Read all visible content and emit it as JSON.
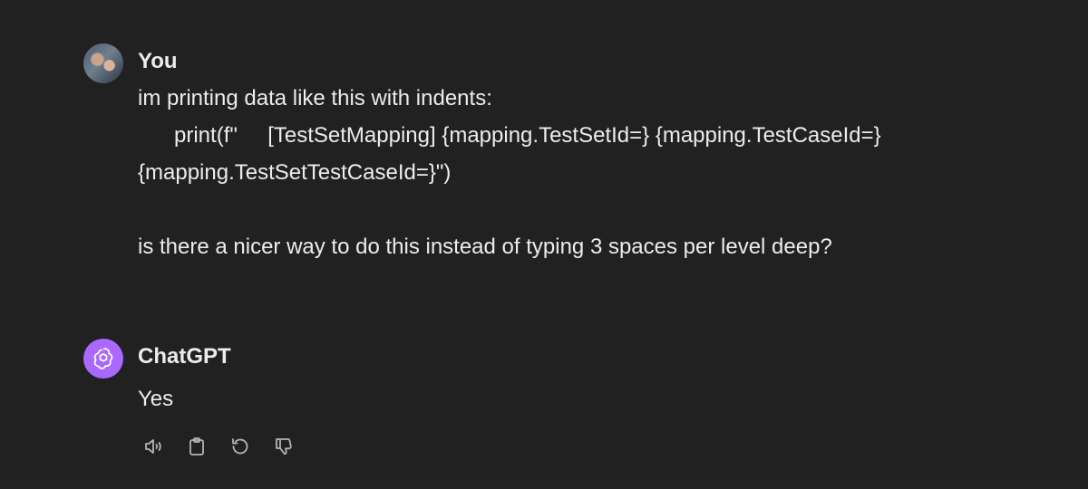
{
  "conversation": {
    "user": {
      "author": "You",
      "lines": [
        "im printing data like this with indents:",
        "      print(f\"     [TestSetMapping] {mapping.TestSetId=} {mapping.TestCaseId=}",
        "{mapping.TestSetTestCaseId=}\")",
        "",
        "is there a nicer way to do this instead of typing 3 spaces per level deep?"
      ]
    },
    "assistant": {
      "author": "ChatGPT",
      "text": "Yes",
      "actions": [
        {
          "icon": "speaker-icon"
        },
        {
          "icon": "clipboard-icon"
        },
        {
          "icon": "regenerate-icon"
        },
        {
          "icon": "thumbs-down-icon"
        }
      ]
    }
  },
  "colors": {
    "background": "#212121",
    "text": "#ececec",
    "icon": "#b4b4b4",
    "assistant_avatar": "#ab68ff"
  }
}
